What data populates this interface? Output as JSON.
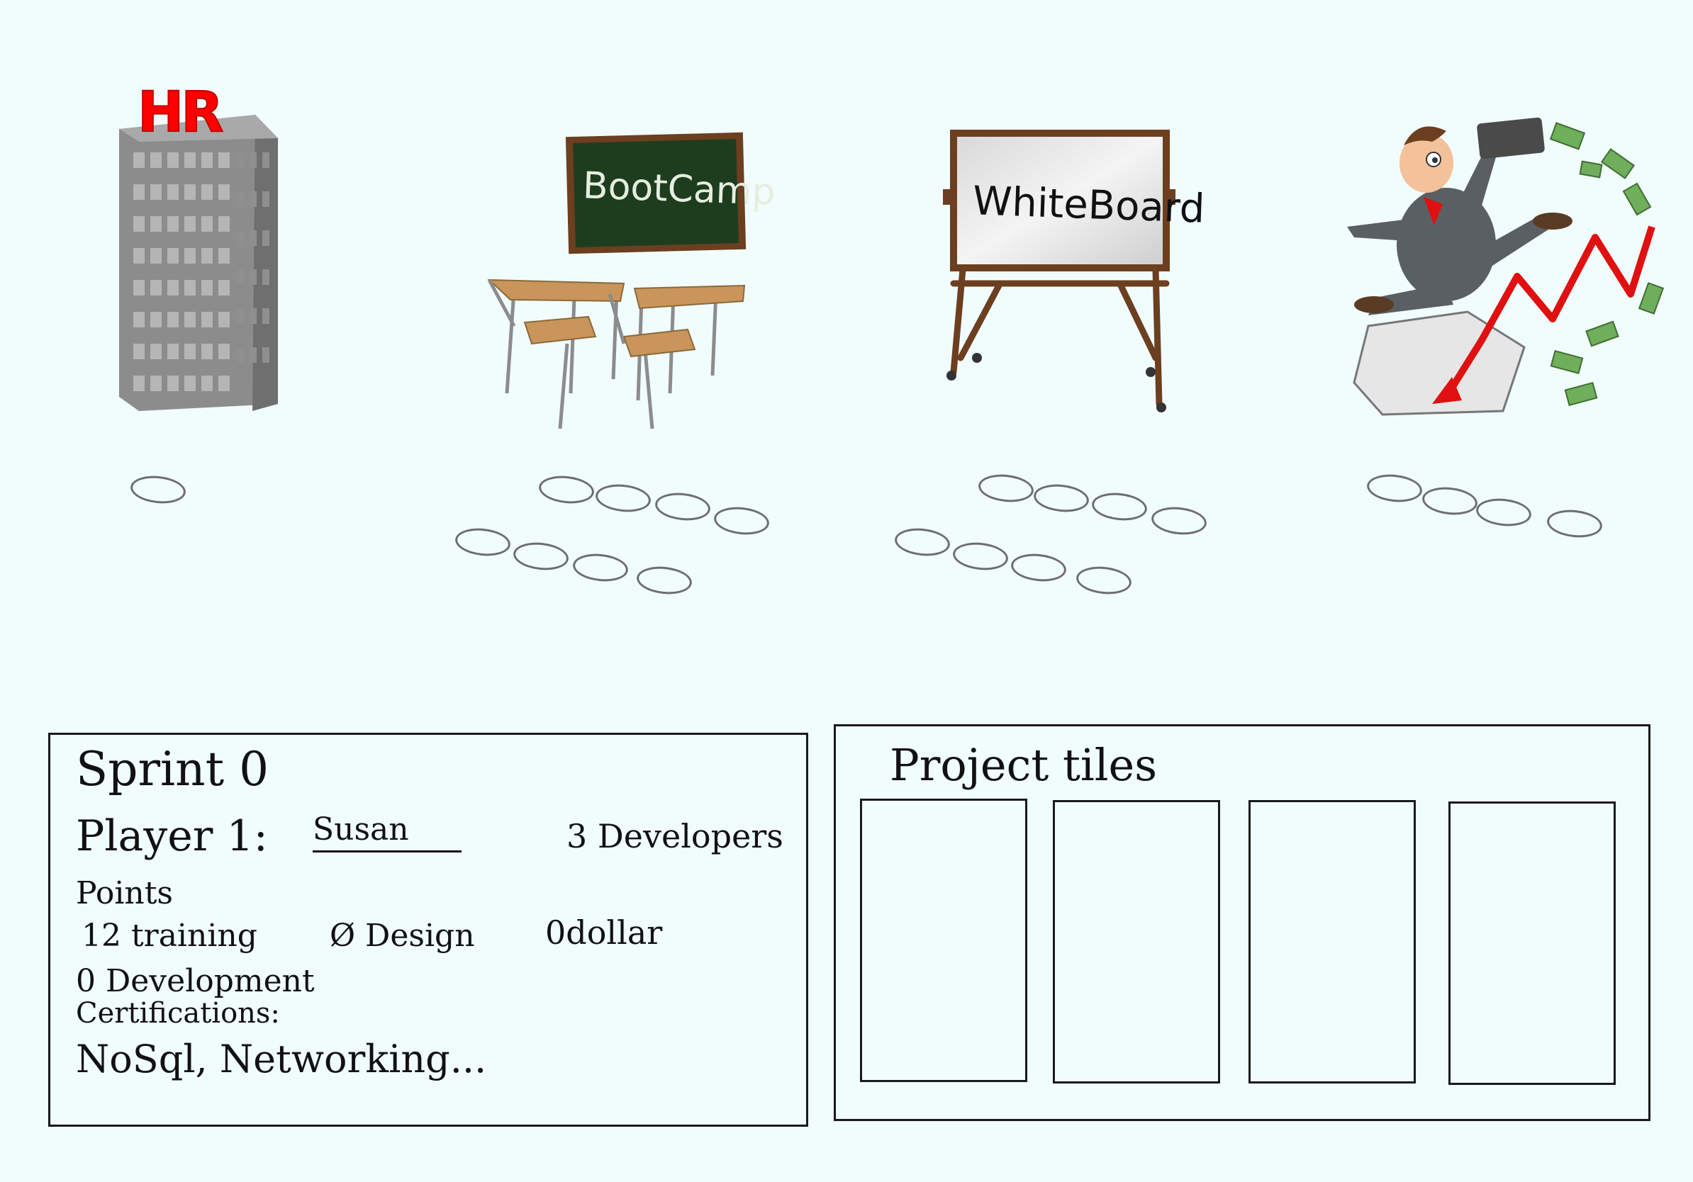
{
  "locations": [
    {
      "id": "hr",
      "sign": "HR",
      "sign_color": "#ff0000",
      "slot_count": 1
    },
    {
      "id": "bootcamp",
      "sign": "BootCamp",
      "board_color": "#1e3d1e",
      "slot_count": 8
    },
    {
      "id": "whiteboard",
      "sign": "WhiteBoard",
      "slot_count": 8
    },
    {
      "id": "market",
      "slot_count": 4
    }
  ],
  "player_panel": {
    "sprint": "Sprint 0",
    "player_label": "Player 1:",
    "player_name": "Susan",
    "developers": "3 Developers",
    "points_label": "Points",
    "training": "12 training",
    "design": "Ø Design",
    "dollar": "0dollar",
    "development": "0 Development",
    "certifications_label": "Certifications:",
    "certifications": "NoSql, Networking..."
  },
  "project_panel": {
    "title": "Project tiles",
    "tile_count": 4
  },
  "colors": {
    "background": "#f1fcfd",
    "building": "#8a8a8a",
    "wood": "#6b3f1f",
    "arrow": "#e01010",
    "money": "#6fae5a"
  }
}
